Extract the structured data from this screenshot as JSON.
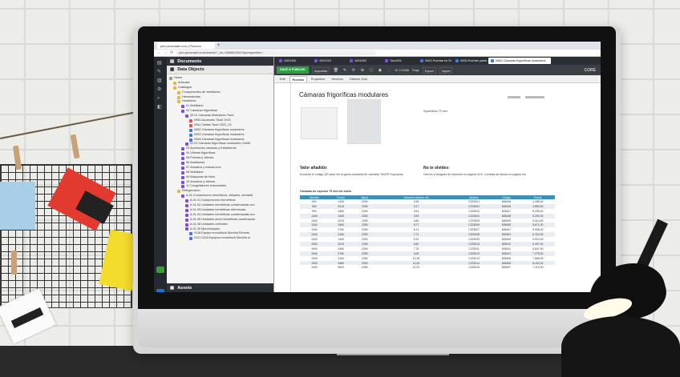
{
  "browser": {
    "tab_title": "pim.pecoradd.com | Pimcore",
    "url": "pim.pecoradd.com/admin/?_dc=1656903347&perspective="
  },
  "rail": {
    "top_label": "Documents",
    "data_label": "Data Objects",
    "assets_label": "Assets"
  },
  "tree": [
    {
      "label": "Home",
      "depth": 0,
      "color": "#999"
    },
    {
      "label": "Articulos",
      "depth": 1,
      "color": "#e6b73b"
    },
    {
      "label": "Catalogos",
      "depth": 1,
      "color": "#e6b73b"
    },
    {
      "label": "Componentes de ventilacion",
      "depth": 2,
      "color": "#e6b73b"
    },
    {
      "label": "Herramientas",
      "depth": 2,
      "color": "#e6b73b"
    },
    {
      "label": "Hostelería",
      "depth": 2,
      "color": "#e6b73b"
    },
    {
      "label": "01 Mobiliario",
      "depth": 3,
      "color": "#7d4fd8"
    },
    {
      "label": "02 Cámaras frigoríficas",
      "depth": 3,
      "color": "#7d4fd8"
    },
    {
      "label": "02.01 Cámaras Modulares Tavel",
      "depth": 4,
      "color": "#7d4fd8"
    },
    {
      "label": "0060-Accesorio Tavel 2023",
      "depth": 5,
      "color": "#e0554c"
    },
    {
      "label": "0061-Tarifas Tavel 2022_23",
      "depth": 5,
      "color": "#e0554c"
    },
    {
      "label": "0062-Cámaras frigoríficas modulares",
      "depth": 5,
      "color": "#3e7be0"
    },
    {
      "label": "0063-Cámaras frigoríficas modulares",
      "depth": 5,
      "color": "#3e7be0"
    },
    {
      "label": "0064-Cámaras frigoríficas modulares",
      "depth": 5,
      "color": "#3e7be0"
    },
    {
      "label": "02.02 Cámaras frigoríficas modulares CAMA",
      "depth": 4,
      "color": "#7d4fd8"
    },
    {
      "label": "03 Accesorios cámaras y Estanterías",
      "depth": 3,
      "color": "#7d4fd8"
    },
    {
      "label": "04 Vitrinas frigoríficas",
      "depth": 3,
      "color": "#7d4fd8"
    },
    {
      "label": "05 Puertas y vitrinas",
      "depth": 3,
      "color": "#7d4fd8"
    },
    {
      "label": "06 Abatidores",
      "depth": 3,
      "color": "#7d4fd8"
    },
    {
      "label": "07 Armarios y mesas inox",
      "depth": 3,
      "color": "#7d4fd8"
    },
    {
      "label": "08 Mobiliario",
      "depth": 3,
      "color": "#7d4fd8"
    },
    {
      "label": "09 Máquinas de hielo",
      "depth": 3,
      "color": "#7d4fd8"
    },
    {
      "label": "10 Armarios y vitrinas",
      "depth": 3,
      "color": "#7d4fd8"
    },
    {
      "label": "11 Congeladores horizontales",
      "depth": 3,
      "color": "#7d4fd8"
    },
    {
      "label": "Refrigeración",
      "depth": 2,
      "color": "#e6b73b"
    },
    {
      "label": "A.01 Compresores herméticos, sellados, semisell",
      "depth": 3,
      "color": "#7d4fd8"
    },
    {
      "label": "A.01.01 Compresores herméticos",
      "depth": 4,
      "color": "#7d4fd8"
    },
    {
      "label": "A.01.02 Unidades herméticas condensadas con",
      "depth": 4,
      "color": "#7d4fd8"
    },
    {
      "label": "A.01.03 Unidades herméticas silenciosas",
      "depth": 4,
      "color": "#7d4fd8"
    },
    {
      "label": "A.01.04 Unidades herméticas condensadas con",
      "depth": 4,
      "color": "#7d4fd8"
    },
    {
      "label": "A.01.05 Unidades semi-herméticas condensada",
      "depth": 4,
      "color": "#7d4fd8"
    },
    {
      "label": "A.01.06 Unidades centrales",
      "depth": 4,
      "color": "#7d4fd8"
    },
    {
      "label": "A.01.30 Monobloques",
      "depth": 4,
      "color": "#7d4fd8"
    },
    {
      "label": "0116-Equipo monoblock Mochila Remoto",
      "depth": 5,
      "color": "#3e7be0"
    },
    {
      "label": "0117-0118 Equipos monoblock Mochila re",
      "depth": 5,
      "color": "#3e7be0"
    }
  ],
  "open_tabs": [
    {
      "label": "1001008",
      "color": "#7d4fd8"
    },
    {
      "label": "1001015",
      "color": "#7d4fd8"
    },
    {
      "label": "1001053",
      "color": "#7d4fd8"
    },
    {
      "label": "Tubo001",
      "color": "#7d4fd8"
    },
    {
      "label": "0002-Puertas en Stock",
      "color": "#3e7be0"
    },
    {
      "label": "0009-Puertas pantalla Tecnik",
      "color": "#3e7be0"
    },
    {
      "label": "0062-Cámaras frigoríficas modulares",
      "color": "#3e7be0"
    }
  ],
  "toolbar": {
    "save_label": "SAVE & PUBLISH",
    "unpublish_label": "Unpublish",
    "id_label": "ID 174538",
    "page_label": "Page",
    "export_label": "Export",
    "import_label": "Import"
  },
  "view_tabs": [
    "Edit",
    "Preview",
    "Properties",
    "Versions",
    "Obtener Grid"
  ],
  "logo": "CORE",
  "doc": {
    "title": "Cámaras frigoríficas modulares",
    "caption": "Superficies 70 mm",
    "value_h": "Valor añadido:",
    "value_t": "Escanee el código QR para ver la gama completa de cámaras TAVER Superplus",
    "note_h": "No te olvides:",
    "note_t": "Cierres y bisagras de repuesto en página XXX. Cortinas de lamas en página xxx",
    "table_title": "Cámaras de espesor 70 mm sin suelo",
    "headers": [
      "Medida",
      "Fondo",
      "Altura",
      "Volumen exterior m3",
      "Modelo",
      "Código",
      "Precio"
    ],
    "rows": [
      [
        "900",
        "1440",
        "2250",
        "2,55",
        "C223001",
        "605445",
        "4.458,00"
      ],
      [
        "900",
        "2010",
        "2250",
        "3,17",
        "C223002",
        "605446",
        "4.863,00"
      ],
      [
        "900",
        "2460",
        "2250",
        "3,91",
        "C223003",
        "605447",
        "5.239,00"
      ],
      [
        "1340",
        "1440",
        "2250",
        "3,93",
        "C223004",
        "605448",
        "5.292,00"
      ],
      [
        "1340",
        "2010",
        "2250",
        "4,80",
        "C223005",
        "605449",
        "5.414,00"
      ],
      [
        "1340",
        "2460",
        "2250",
        "5,77",
        "C223006",
        "605450",
        "5.671,00"
      ],
      [
        "1340",
        "2760",
        "2250",
        "6,74",
        "C223007",
        "605447",
        "5.908,00"
      ],
      [
        "1340",
        "3160",
        "2250",
        "7,71",
        "C223008",
        "605451",
        "6.194,00"
      ],
      [
        "1940",
        "1440",
        "2250",
        "5,15",
        "C223009",
        "605409",
        "5.924,00"
      ],
      [
        "1940",
        "2010",
        "2250",
        "6,50",
        "C223010",
        "605410",
        "6.407,00"
      ],
      [
        "1940",
        "2460",
        "2250",
        "7,78",
        "C223011",
        "605411",
        "6.847,00"
      ],
      [
        "1940",
        "2760",
        "2250",
        "9,25",
        "C223012",
        "605421",
        "7.275,00"
      ],
      [
        "1940",
        "3160",
        "2250",
        "10,33",
        "C223013",
        "605405",
        "7.856,00"
      ],
      [
        "1940",
        "3460",
        "2250",
        "11,63",
        "C223014",
        "605406",
        "8.404,00"
      ],
      [
        "1940",
        "3920",
        "2250",
        "12,91",
        "C223015",
        "605407",
        "7.212,00"
      ]
    ]
  }
}
